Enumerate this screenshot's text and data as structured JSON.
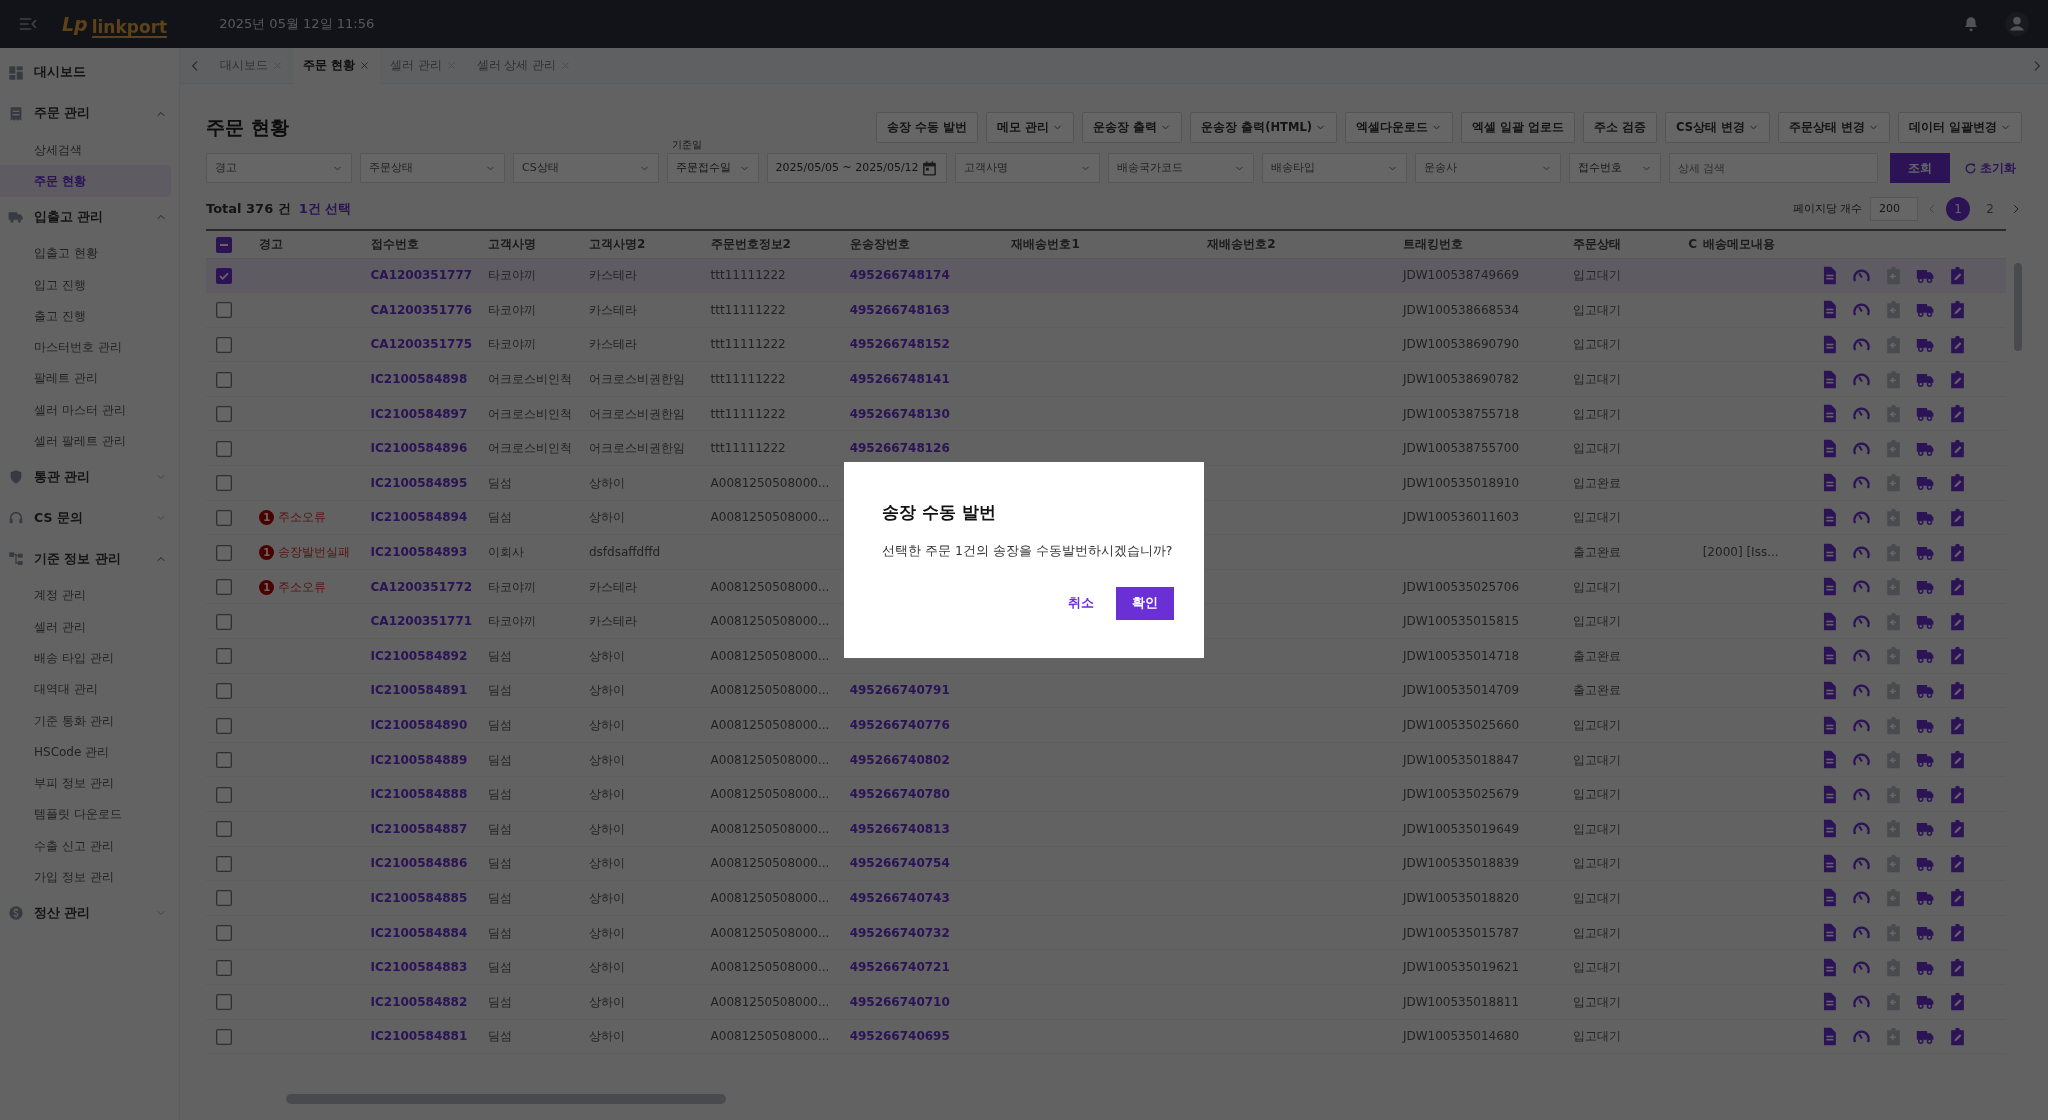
{
  "topbar": {
    "logo_mark": "Lp",
    "logo_name": "linkport",
    "datetime": "2025년 05월 12일 11:56"
  },
  "sidebar": {
    "groups": [
      {
        "label": "대시보드"
      },
      {
        "label": "주문 관리",
        "expanded": true,
        "children": [
          {
            "label": "상세검색",
            "selected": false
          },
          {
            "label": "주문 현황",
            "selected": true
          }
        ]
      },
      {
        "label": "입출고 관리",
        "expanded": true,
        "children": [
          {
            "label": "입출고 현황",
            "selected": false
          },
          {
            "label": "입고 진행",
            "selected": false
          },
          {
            "label": "출고 진행",
            "selected": false
          },
          {
            "label": "마스터번호 관리",
            "selected": false
          },
          {
            "label": "팔레트 관리",
            "selected": false
          },
          {
            "label": "셀러 마스터 관리",
            "selected": false
          },
          {
            "label": "셀러 팔레트 관리",
            "selected": false
          }
        ]
      },
      {
        "label": "통관 관리",
        "expanded": false
      },
      {
        "label": "CS 문의",
        "expanded": false
      },
      {
        "label": "기준 정보 관리",
        "expanded": true,
        "children": [
          {
            "label": "계정 관리",
            "selected": false
          },
          {
            "label": "셀러 관리",
            "selected": false
          },
          {
            "label": "배송 타입 관리",
            "selected": false
          },
          {
            "label": "대역대 관리",
            "selected": false
          },
          {
            "label": "기준 통화 관리",
            "selected": false
          },
          {
            "label": "HSCode 관리",
            "selected": false
          },
          {
            "label": "부피 정보 관리",
            "selected": false
          },
          {
            "label": "템플릿 다운로드",
            "selected": false
          },
          {
            "label": "수출 신고 관리",
            "selected": false
          },
          {
            "label": "가입 정보 관리",
            "selected": false
          }
        ]
      },
      {
        "label": "정산 관리",
        "expanded": false
      }
    ]
  },
  "tabs": [
    {
      "label": "대시보드",
      "selected": false
    },
    {
      "label": "주문 현황",
      "selected": true
    },
    {
      "label": "셀러 관리",
      "selected": false
    },
    {
      "label": "셀러 상세 관리",
      "selected": false
    }
  ],
  "page_title": "주문 현황",
  "toolbar": [
    {
      "label": "송장 수동 발번",
      "dropdown": false
    },
    {
      "label": "메모 관리",
      "dropdown": true
    },
    {
      "label": "운송장 출력",
      "dropdown": true
    },
    {
      "label": "운송장 출력(HTML)",
      "dropdown": true
    },
    {
      "label": "엑셀다운로드",
      "dropdown": true
    },
    {
      "label": "엑셀 일괄 업로드",
      "dropdown": false
    },
    {
      "label": "주소 검증",
      "dropdown": false
    },
    {
      "label": "CS상태 변경",
      "dropdown": true
    },
    {
      "label": "주문상태 변경",
      "dropdown": true
    },
    {
      "label": "데이터 일괄변경",
      "dropdown": true
    }
  ],
  "filters": [
    {
      "kind": "select",
      "placeholder": "경고"
    },
    {
      "kind": "select",
      "placeholder": "주문상태"
    },
    {
      "kind": "select",
      "placeholder": "CS상태"
    },
    {
      "kind": "select",
      "label": "기준일",
      "value": "주문접수일"
    },
    {
      "kind": "date",
      "value": "2025/05/05 ~ 2025/05/12"
    },
    {
      "kind": "select",
      "placeholder": "고객사명"
    },
    {
      "kind": "select",
      "placeholder": "배송국가코드"
    },
    {
      "kind": "select",
      "placeholder": "배송타입"
    },
    {
      "kind": "select",
      "placeholder": "운송사"
    },
    {
      "kind": "select",
      "value": "접수번호"
    },
    {
      "kind": "input",
      "placeholder": "상세 검색"
    }
  ],
  "search_button": "조회",
  "reset_button": "초기화",
  "summary": {
    "total": "Total 376 건",
    "selected": "1건 선택"
  },
  "pagination": {
    "label": "페이지당 개수",
    "page_size": "200",
    "pages": [
      {
        "label": "1",
        "selected": true
      },
      {
        "label": "2",
        "selected": false
      }
    ]
  },
  "table": {
    "select_all": {
      "indeterminate": true
    },
    "columns": [
      {
        "label": "경고",
        "kind": "warning"
      },
      {
        "label": "접수번호",
        "kind": "link"
      },
      {
        "label": "고객사명",
        "kind": "text"
      },
      {
        "label": "고객사명2",
        "kind": "text"
      },
      {
        "label": "주문번호정보2",
        "kind": "text"
      },
      {
        "label": "운송장번호",
        "kind": "link"
      },
      {
        "label": "재배송번호1",
        "kind": "text"
      },
      {
        "label": "재배송번호2",
        "kind": "text"
      },
      {
        "label": "트래킹번호",
        "kind": "text"
      },
      {
        "label": "주문상태",
        "kind": "text"
      },
      {
        "label": "C",
        "kind": "text"
      },
      {
        "label": "배송메모내용",
        "kind": "text"
      }
    ],
    "rows": [
      {
        "selected": true,
        "cells": [
          null,
          "CA1200351777",
          "타코야끼",
          "카스테라",
          "ttt11111222",
          "495266748174",
          null,
          null,
          "JDW100538749669",
          "입고대기",
          null,
          null
        ]
      },
      {
        "selected": false,
        "cells": [
          null,
          "CA1200351776",
          "타코야끼",
          "카스테라",
          "ttt11111222",
          "495266748163",
          null,
          null,
          "JDW100538668534",
          "입고대기",
          null,
          null
        ]
      },
      {
        "selected": false,
        "cells": [
          null,
          "CA1200351775",
          "타코야끼",
          "카스테라",
          "ttt11111222",
          "495266748152",
          null,
          null,
          "JDW100538690790",
          "입고대기",
          null,
          null
        ]
      },
      {
        "selected": false,
        "cells": [
          null,
          "IC2100584898",
          "어크로스비인척",
          "어크로스비권한임",
          "ttt11111222",
          "495266748141",
          null,
          null,
          "JDW100538690782",
          "입고대기",
          null,
          null
        ]
      },
      {
        "selected": false,
        "cells": [
          null,
          "IC2100584897",
          "어크로스비인척",
          "어크로스비권한임",
          "ttt11111222",
          "495266748130",
          null,
          null,
          "JDW100538755718",
          "입고대기",
          null,
          null
        ]
      },
      {
        "selected": false,
        "cells": [
          null,
          "IC2100584896",
          "어크로스비인척",
          "어크로스비권한임",
          "ttt11111222",
          "495266748126",
          null,
          null,
          "JDW100538755700",
          "입고대기",
          null,
          null
        ]
      },
      {
        "selected": false,
        "cells": [
          null,
          "IC2100584895",
          "딤섬",
          "상하이",
          "A0081250508000...",
          null,
          null,
          null,
          "JDW100535018910",
          "입고완료",
          null,
          null
        ]
      },
      {
        "selected": false,
        "cells": [
          {
            "count": "1",
            "label": "주소오류"
          },
          "IC2100584894",
          "딤섬",
          "상하이",
          "A0081250508000...",
          null,
          null,
          null,
          "JDW100536011603",
          "입고대기",
          null,
          null
        ]
      },
      {
        "selected": false,
        "cells": [
          {
            "count": "1",
            "label": "송장발번실패"
          },
          "IC2100584893",
          "이회사",
          "dsfdsaffdffd",
          null,
          null,
          null,
          null,
          null,
          "출고완료",
          null,
          "[2000] [Iss..."
        ]
      },
      {
        "selected": false,
        "cells": [
          {
            "count": "1",
            "label": "주소오류"
          },
          "CA1200351772",
          "타코야끼",
          "카스테라",
          "A0081250508000...",
          null,
          null,
          null,
          "JDW100535025706",
          "입고대기",
          null,
          null
        ]
      },
      {
        "selected": false,
        "cells": [
          null,
          "CA1200351771",
          "타코야끼",
          "카스테라",
          "A0081250508000...",
          null,
          null,
          null,
          "JDW100535015815",
          "입고대기",
          null,
          null
        ]
      },
      {
        "selected": false,
        "cells": [
          null,
          "IC2100584892",
          "딤섬",
          "상하이",
          "A0081250508000...",
          null,
          null,
          null,
          "JDW100535014718",
          "출고완료",
          null,
          null
        ]
      },
      {
        "selected": false,
        "cells": [
          null,
          "IC2100584891",
          "딤섬",
          "상하이",
          "A0081250508000...",
          "495266740791",
          null,
          null,
          "JDW100535014709",
          "출고완료",
          null,
          null
        ]
      },
      {
        "selected": false,
        "cells": [
          null,
          "IC2100584890",
          "딤섬",
          "상하이",
          "A0081250508000...",
          "495266740776",
          null,
          null,
          "JDW100535025660",
          "입고대기",
          null,
          null
        ]
      },
      {
        "selected": false,
        "cells": [
          null,
          "IC2100584889",
          "딤섬",
          "상하이",
          "A0081250508000...",
          "495266740802",
          null,
          null,
          "JDW100535018847",
          "입고대기",
          null,
          null
        ]
      },
      {
        "selected": false,
        "cells": [
          null,
          "IC2100584888",
          "딤섬",
          "상하이",
          "A0081250508000...",
          "495266740780",
          null,
          null,
          "JDW100535025679",
          "입고대기",
          null,
          null
        ]
      },
      {
        "selected": false,
        "cells": [
          null,
          "IC2100584887",
          "딤섬",
          "상하이",
          "A0081250508000...",
          "495266740813",
          null,
          null,
          "JDW100535019649",
          "입고대기",
          null,
          null
        ]
      },
      {
        "selected": false,
        "cells": [
          null,
          "IC2100584886",
          "딤섬",
          "상하이",
          "A0081250508000...",
          "495266740754",
          null,
          null,
          "JDW100535018839",
          "입고대기",
          null,
          null
        ]
      },
      {
        "selected": false,
        "cells": [
          null,
          "IC2100584885",
          "딤섬",
          "상하이",
          "A0081250508000...",
          "495266740743",
          null,
          null,
          "JDW100535018820",
          "입고대기",
          null,
          null
        ]
      },
      {
        "selected": false,
        "cells": [
          null,
          "IC2100584884",
          "딤섬",
          "상하이",
          "A0081250508000...",
          "495266740732",
          null,
          null,
          "JDW100535015787",
          "입고대기",
          null,
          null
        ]
      },
      {
        "selected": false,
        "cells": [
          null,
          "IC2100584883",
          "딤섬",
          "상하이",
          "A0081250508000...",
          "495266740721",
          null,
          null,
          "JDW100535019621",
          "입고대기",
          null,
          null
        ]
      },
      {
        "selected": false,
        "cells": [
          null,
          "IC2100584882",
          "딤섬",
          "상하이",
          "A0081250508000...",
          "495266740710",
          null,
          null,
          "JDW100535018811",
          "입고대기",
          null,
          null
        ]
      },
      {
        "selected": false,
        "cells": [
          null,
          "IC2100584881",
          "딤섬",
          "상하이",
          "A0081250508000...",
          "495266740695",
          null,
          null,
          "JDW100535014680",
          "입고대기",
          null,
          null
        ]
      }
    ]
  },
  "dialog": {
    "title": "송장 수동 발번",
    "message": "선택한 주문 1건의 송장을 수동발번하시겠습니까?",
    "cancel": "취소",
    "confirm": "확인"
  }
}
